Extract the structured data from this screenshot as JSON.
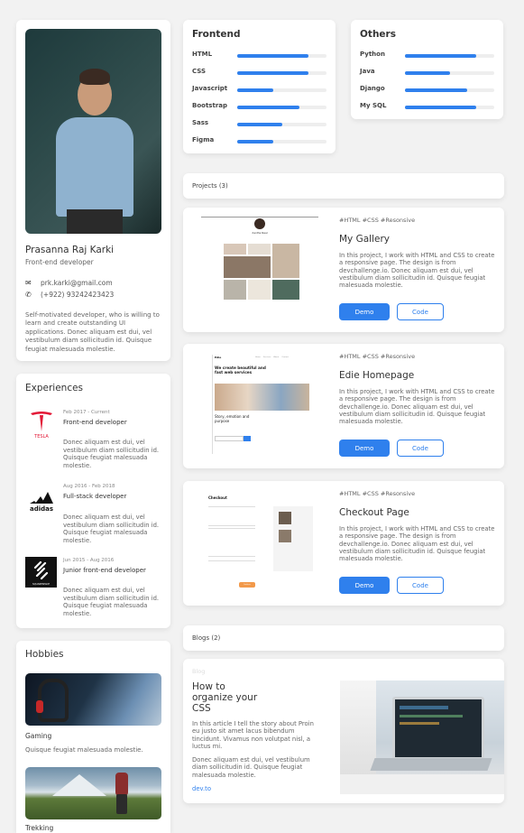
{
  "profile": {
    "name": "Prasanna Raj Karki",
    "role": "Front-end developer",
    "email": "prk.karki@gmail.com",
    "phone": "(+922) 93242423423",
    "bio": "Self-motivated developer, who is willing to learn and create outstanding UI applications. Donec aliquam est dui, vel vestibulum diam sollicitudin id. Quisque feugiat malesuada molestie."
  },
  "experiences": {
    "title": "Experiences",
    "items": [
      {
        "logo": "tesla-logo",
        "logo_text": "TESLA",
        "date": "Feb 2017 - Current",
        "title": "Front-end developer",
        "desc": "Donec aliquam est dui, vel vestibulum diam sollicitudin id. Quisque feugiat malesuada molestie."
      },
      {
        "logo": "adidas-logo",
        "logo_text": "adidas",
        "date": "Aug 2016 - Feb 2018",
        "title": "Full-stack developer",
        "desc": "Donec aliquam est dui, vel vestibulum diam sollicitudin id. Quisque feugiat malesuada molestie."
      },
      {
        "logo": "squarespace-logo",
        "logo_text": "SQUARESPACE",
        "date": "Jun 2015 - Aug 2016",
        "title": "Junior front-end developer",
        "desc": "Donec aliquam est dui, vel vestibulum diam sollicitudin id. Quisque feugiat malesuada molestie."
      }
    ]
  },
  "hobbies": {
    "title": "Hobbies",
    "items": [
      {
        "name": "Gaming",
        "desc": "Quisque feugiat malesuada molestie."
      },
      {
        "name": "Trekking",
        "desc": ""
      }
    ]
  },
  "skills": {
    "frontend": {
      "title": "Frontend",
      "items": [
        {
          "name": "HTML",
          "level": 0.8
        },
        {
          "name": "CSS",
          "level": 0.8
        },
        {
          "name": "Javascript",
          "level": 0.4
        },
        {
          "name": "Bootstrap",
          "level": 0.7
        },
        {
          "name": "Sass",
          "level": 0.5
        },
        {
          "name": "Figma",
          "level": 0.4
        }
      ]
    },
    "others": {
      "title": "Others",
      "items": [
        {
          "name": "Python",
          "level": 0.8
        },
        {
          "name": "Java",
          "level": 0.5
        },
        {
          "name": "Django",
          "level": 0.7
        },
        {
          "name": "My SQL",
          "level": 0.8
        }
      ]
    }
  },
  "projects": {
    "label": "Projects (3)",
    "items": [
      {
        "tags": "#HTML #CSS #Resonsive",
        "title": "My Gallery",
        "desc": "In this project, I work with HTML and CSS to create a responsive page. The design is from devchallenge.io. Donec aliquam est dui, vel vestibulum diam sollicitudin id. Quisque feugiat malesuada molestie.",
        "demo": "Demo",
        "code": "Code"
      },
      {
        "tags": "#HTML #CSS #Resonsive",
        "title": "Edie Homepage",
        "desc": "In this project, I work with HTML and CSS to create a responsive page. The design is from devchallenge.io. Donec aliquam est dui, vel vestibulum diam sollicitudin id. Quisque feugiat malesuada molestie.",
        "demo": "Demo",
        "code": "Code"
      },
      {
        "tags": "#HTML #CSS #Resonsive",
        "title": "Checkout Page",
        "desc": "In this project, I work with HTML and CSS to create a responsive page. The design is from devchallenge.io. Donec aliquam est dui, vel vestibulum diam sollicitudin id. Quisque feugiat malesuada molestie.",
        "demo": "Demo",
        "code": "Code"
      }
    ]
  },
  "blogs": {
    "label": "Blogs (2)",
    "items": [
      {
        "tag": "Blog",
        "title": "How to organize your CSS",
        "p1": "In this article I tell the story about Proin eu justo sit amet lacus bibendum tincidunt. Vivamus non volutpat nisl, a luctus mi.",
        "p2": "Donec aliquam est dui, vel vestibulum diam sollicitudin id. Quisque feugiat malesuada molestie.",
        "link": "dev.to"
      }
    ]
  },
  "thumbs": {
    "gallery": {
      "name": "Xanthe Neal"
    },
    "edie": {
      "brand": "Edie",
      "nav1": "Home",
      "nav2": "Services",
      "nav3": "About",
      "nav4": "Contact",
      "headline": "We create beautiful and fast web services",
      "sub": "Story, emotion and purpose"
    },
    "checkout": {
      "title": "Checkout",
      "button": "Continue"
    }
  },
  "colors": {
    "accent": "#2f80ed",
    "background": "#f2f2f2"
  }
}
